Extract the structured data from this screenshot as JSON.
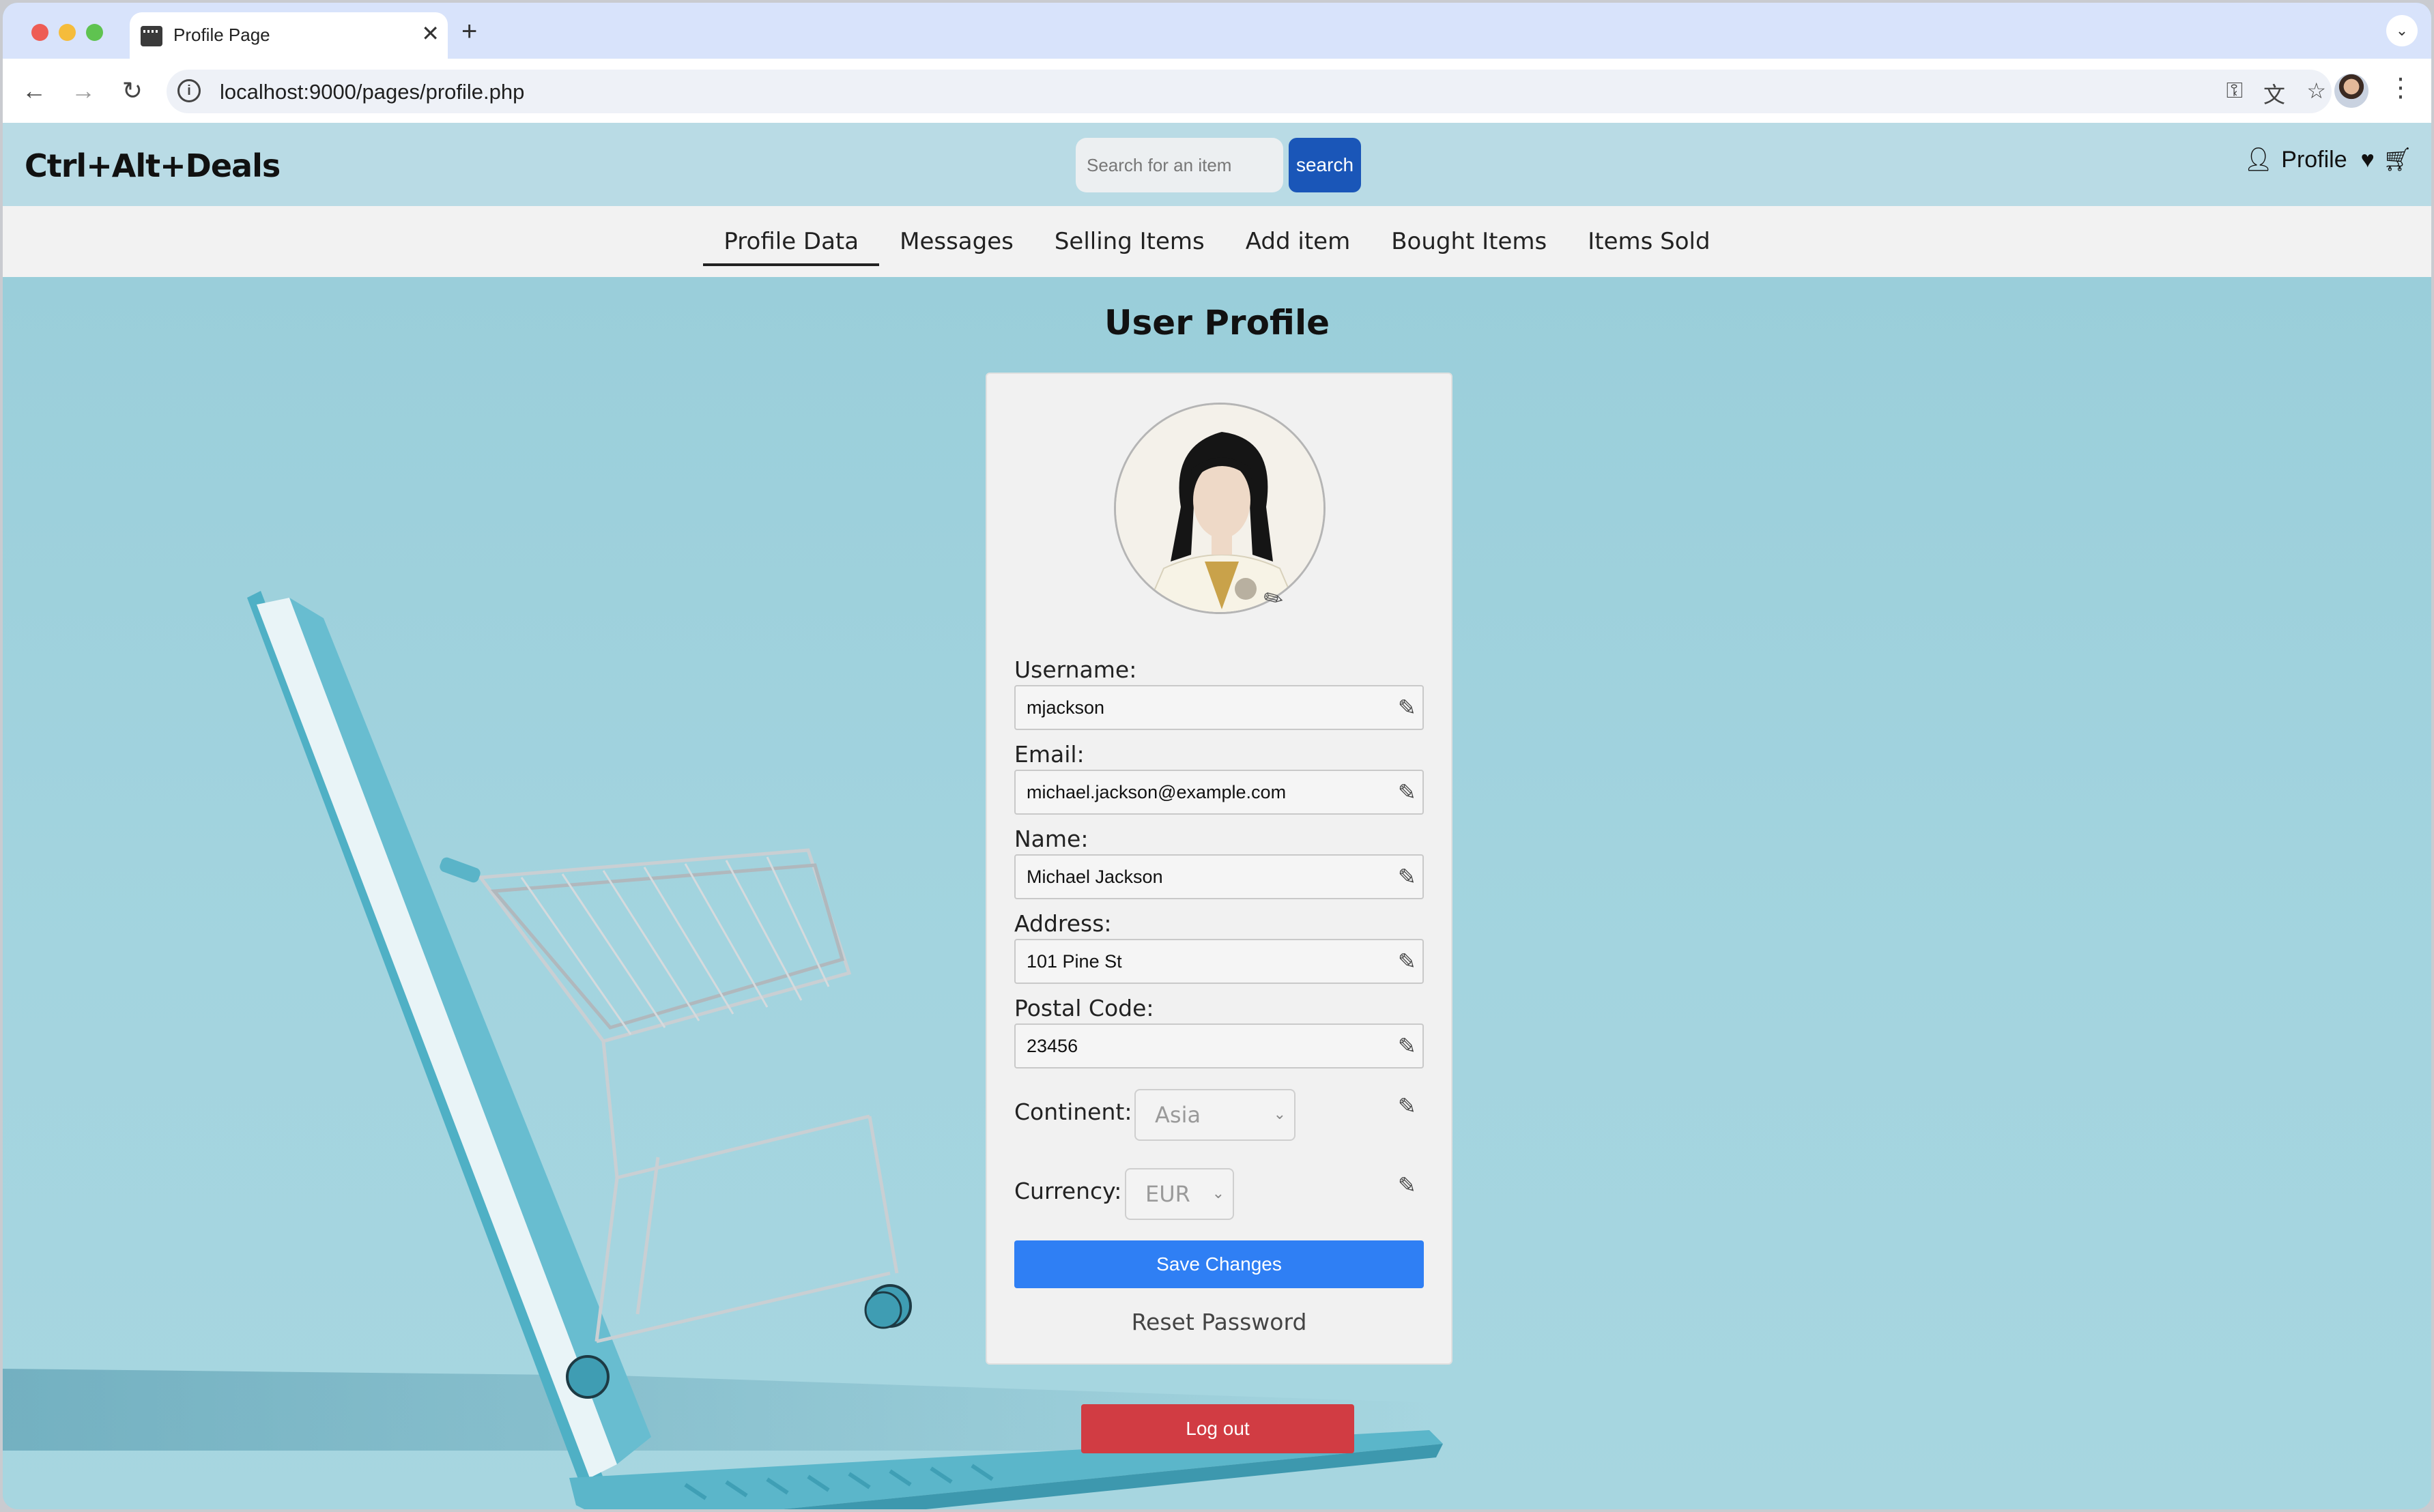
{
  "browser": {
    "tab_title": "Profile Page",
    "url": "localhost:9000/pages/profile.php"
  },
  "site": {
    "logo": "Ctrl+Alt+Deals",
    "search_placeholder": "Search for an item",
    "search_button": "search",
    "profile_link": "Profile"
  },
  "subnav": {
    "items": [
      "Profile Data",
      "Messages",
      "Selling Items",
      "Add item",
      "Bought Items",
      "Items Sold"
    ],
    "active_index": 0
  },
  "profile": {
    "heading": "User Profile",
    "username_label": "Username:",
    "username": "mjackson",
    "email_label": "Email:",
    "email": "michael.jackson@example.com",
    "name_label": "Name:",
    "name": "Michael Jackson",
    "address_label": "Address:",
    "address": "101 Pine St",
    "postal_label": "Postal Code:",
    "postal_code": "23456",
    "continent_label": "Continent:",
    "continent": "Asia",
    "currency_label": "Currency:",
    "currency": "EUR",
    "save_button": "Save Changes",
    "reset_password": "Reset Password",
    "logout_button": "Log out"
  },
  "colors": {
    "header_bg": "#b9dbe5",
    "search_button": "#1a56b8",
    "save_button": "#2f7ff4",
    "logout_button": "#d13c43",
    "page_bg": "#a3d4df"
  }
}
